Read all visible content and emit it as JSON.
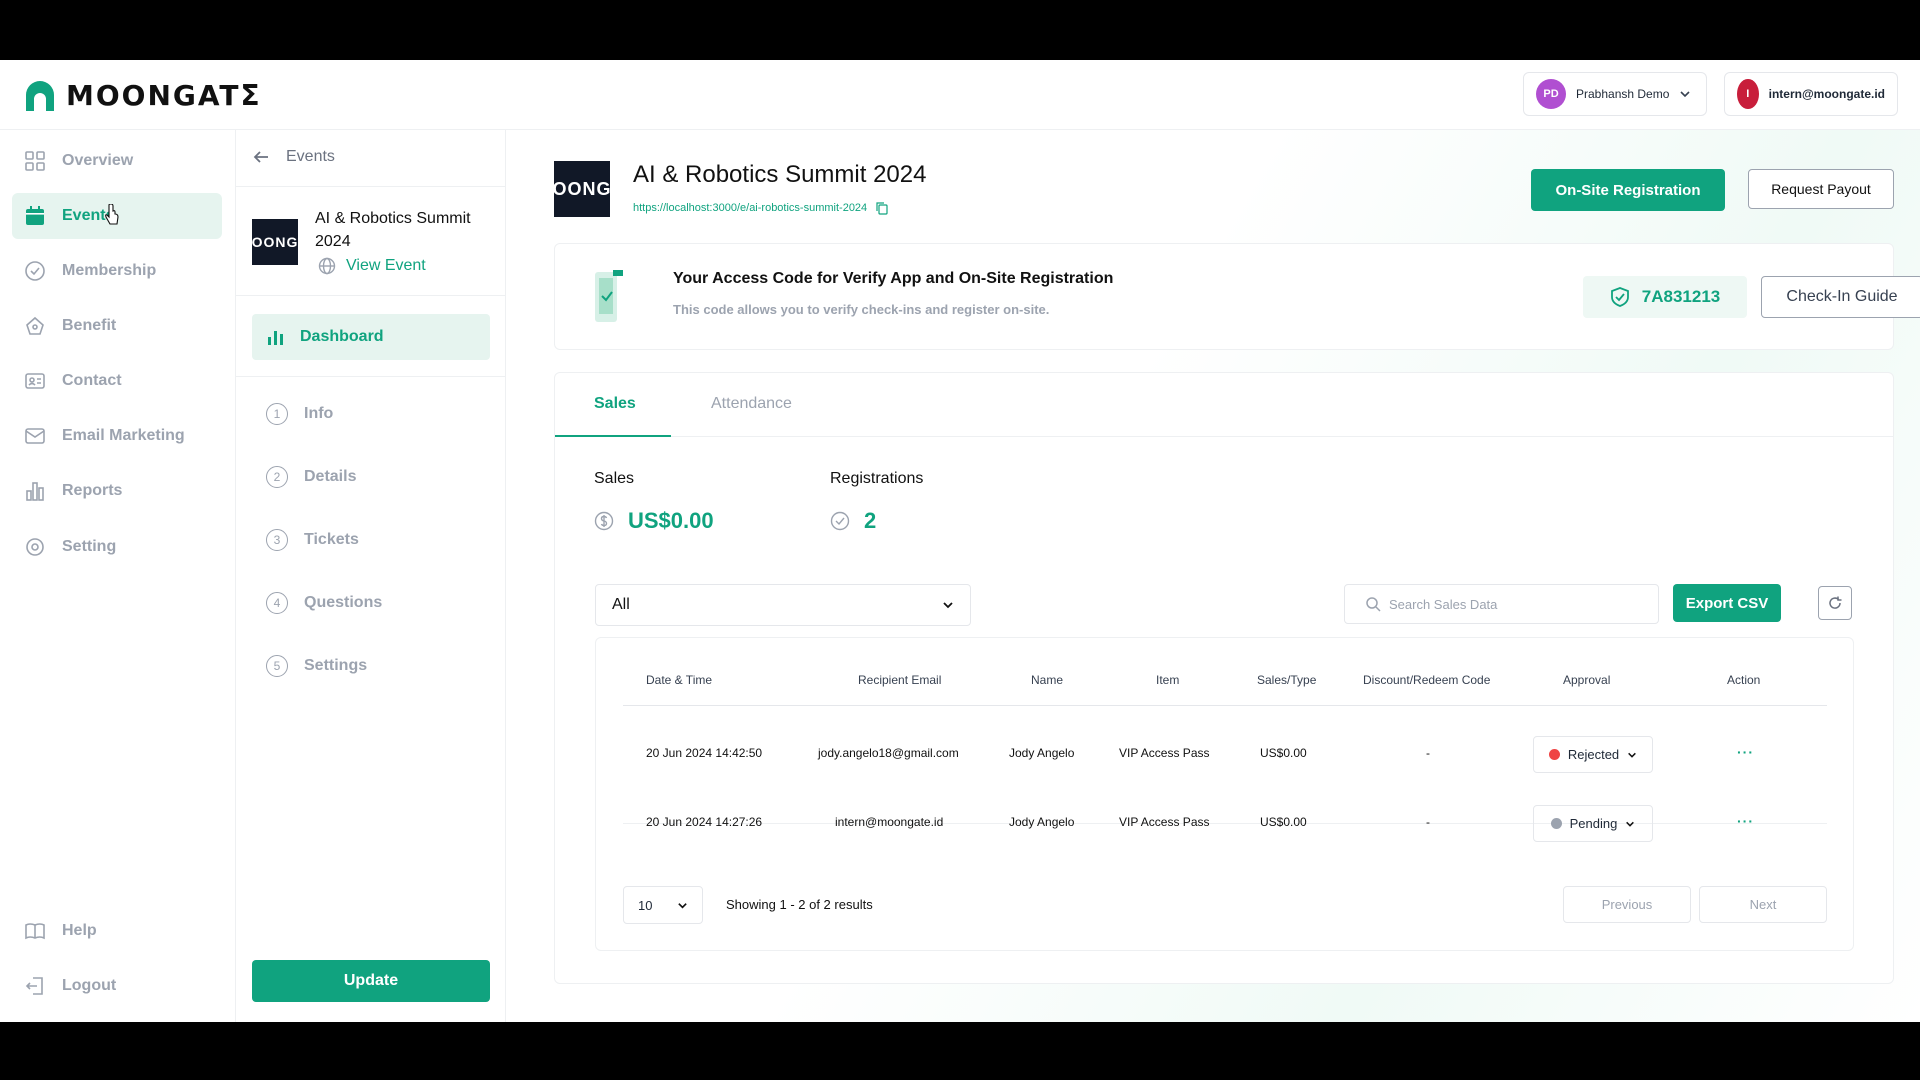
{
  "brand": {
    "name": "MOONGATΣ",
    "accent": "#10a37f"
  },
  "header": {
    "org": {
      "initials": "PD",
      "name": "Prabhansh Demo",
      "color": "#b04fd1"
    },
    "user": {
      "initial": "I",
      "email": "intern@moongate.id",
      "color": "#c81e3b"
    }
  },
  "sidebar": {
    "items": [
      {
        "label": "Overview",
        "icon": "grid-icon"
      },
      {
        "label": "Events",
        "icon": "calendar-icon",
        "active": true
      },
      {
        "label": "Membership",
        "icon": "badge-check-icon"
      },
      {
        "label": "Benefit",
        "icon": "gift-icon"
      },
      {
        "label": "Contact",
        "icon": "contact-card-icon"
      },
      {
        "label": "Email Marketing",
        "icon": "mail-icon"
      },
      {
        "label": "Reports",
        "icon": "bar-chart-icon"
      },
      {
        "label": "Setting",
        "icon": "gear-icon"
      }
    ],
    "bottom": [
      {
        "label": "Help",
        "icon": "book-icon"
      },
      {
        "label": "Logout",
        "icon": "logout-icon"
      }
    ]
  },
  "event_panel": {
    "back_label": "Events",
    "event_name": "AI & Robotics Summit 2024",
    "thumb_text": "OONG",
    "view_event": "View Event",
    "dashboard": "Dashboard",
    "steps": [
      {
        "num": "1",
        "label": "Info"
      },
      {
        "num": "2",
        "label": "Details"
      },
      {
        "num": "3",
        "label": "Tickets"
      },
      {
        "num": "4",
        "label": "Questions"
      },
      {
        "num": "5",
        "label": "Settings"
      }
    ],
    "update": "Update"
  },
  "main": {
    "title": "AI & Robotics Summit 2024",
    "url": "https://localhost:3000/e/ai-robotics-summit-2024",
    "onsite_btn": "On-Site Registration",
    "payout_btn": "Request Payout",
    "access": {
      "title": "Your Access Code for Verify App and On-Site Registration",
      "subtitle": "This code allows you to verify check-ins and register on-site.",
      "code": "7A831213",
      "guide_btn": "Check-In Guide"
    },
    "tabs": [
      "Sales",
      "Attendance"
    ],
    "stats": {
      "sales_label": "Sales",
      "sales_value": "US$0.00",
      "reg_label": "Registrations",
      "reg_value": "2"
    },
    "filter": {
      "selected": "All"
    },
    "search_placeholder": "Search Sales Data",
    "export_btn": "Export CSV",
    "table": {
      "columns": [
        "Date & Time",
        "Recipient Email",
        "Name",
        "Item",
        "Sales/Type",
        "Discount/Redeem Code",
        "Approval",
        "Action"
      ],
      "rows": [
        {
          "datetime": "20 Jun 2024 14:42:50",
          "email": "jody.angelo18@gmail.com",
          "name": "Jody Angelo",
          "item": "VIP Access Pass",
          "sales": "US$0.00",
          "code": "-",
          "approval": "Rejected",
          "approval_color": "#ef4444",
          "action": "···"
        },
        {
          "datetime": "20 Jun 2024 14:27:26",
          "email": "intern@moongate.id",
          "name": "Jody Angelo",
          "item": "VIP Access Pass",
          "sales": "US$0.00",
          "code": "-",
          "approval": "Pending",
          "approval_color": "#9ca3af",
          "action": "···"
        }
      ]
    },
    "pagination": {
      "page_size": "10",
      "showing": "Showing 1 - 2 of 2 results",
      "prev": "Previous",
      "next": "Next"
    }
  }
}
